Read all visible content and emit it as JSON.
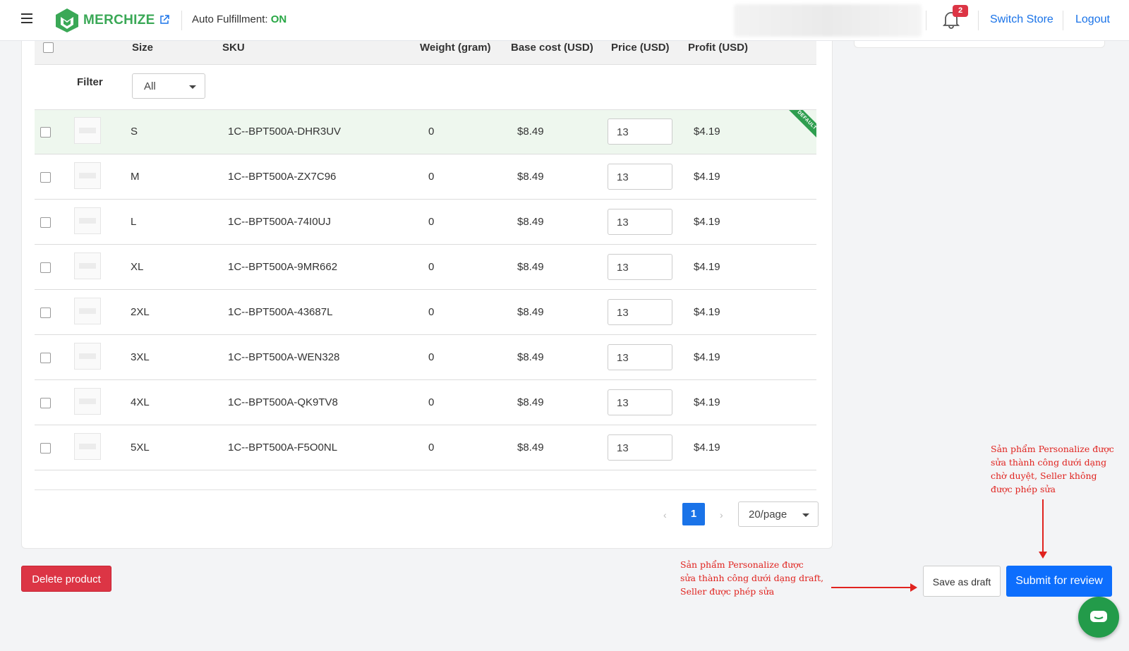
{
  "header": {
    "logo_text": "MERCHIZE",
    "fulfillment_label": "Auto Fulfillment:",
    "fulfillment_status": "ON",
    "notification_count": "2",
    "switch_store": "Switch Store",
    "logout": "Logout"
  },
  "table": {
    "columns": [
      "Size",
      "SKU",
      "Weight (gram)",
      "Base cost (USD)",
      "Price (USD)",
      "Profit (USD)"
    ],
    "filter_label": "Filter",
    "filter_value": "All",
    "default_ribbon": "DEFAULT",
    "rows": [
      {
        "size": "S",
        "sku": "1C--BPT500A-DHR3UV",
        "weight": "0",
        "base_cost": "$8.49",
        "price": "13",
        "profit": "$4.19"
      },
      {
        "size": "M",
        "sku": "1C--BPT500A-ZX7C96",
        "weight": "0",
        "base_cost": "$8.49",
        "price": "13",
        "profit": "$4.19"
      },
      {
        "size": "L",
        "sku": "1C--BPT500A-74I0UJ",
        "weight": "0",
        "base_cost": "$8.49",
        "price": "13",
        "profit": "$4.19"
      },
      {
        "size": "XL",
        "sku": "1C--BPT500A-9MR662",
        "weight": "0",
        "base_cost": "$8.49",
        "price": "13",
        "profit": "$4.19"
      },
      {
        "size": "2XL",
        "sku": "1C--BPT500A-43687L",
        "weight": "0",
        "base_cost": "$8.49",
        "price": "13",
        "profit": "$4.19"
      },
      {
        "size": "3XL",
        "sku": "1C--BPT500A-WEN328",
        "weight": "0",
        "base_cost": "$8.49",
        "price": "13",
        "profit": "$4.19"
      },
      {
        "size": "4XL",
        "sku": "1C--BPT500A-QK9TV8",
        "weight": "0",
        "base_cost": "$8.49",
        "price": "13",
        "profit": "$4.19"
      },
      {
        "size": "5XL",
        "sku": "1C--BPT500A-F5O0NL",
        "weight": "0",
        "base_cost": "$8.49",
        "price": "13",
        "profit": "$4.19"
      }
    ]
  },
  "pagination": {
    "prev": "‹",
    "current_page": "1",
    "next": "›",
    "per_page": "20/page"
  },
  "actions": {
    "delete": "Delete product",
    "save_draft": "Save as draft",
    "submit": "Submit for review"
  },
  "annotations": {
    "draft_note": [
      "Sản phẩm Personalize được",
      "sửa thành công dưới dạng draft,",
      "Seller được phép sửa"
    ],
    "review_note": [
      "Sản phẩm Personalize được",
      "sửa thành công dưới dạng",
      "chờ duyệt, Seller không",
      "được phép sửa"
    ]
  },
  "colors": {
    "brand_green": "#3aa856",
    "link_blue": "#1a73e8",
    "danger": "#dc3545",
    "primary": "#0d6efd",
    "annotation_red": "#e0231f"
  }
}
